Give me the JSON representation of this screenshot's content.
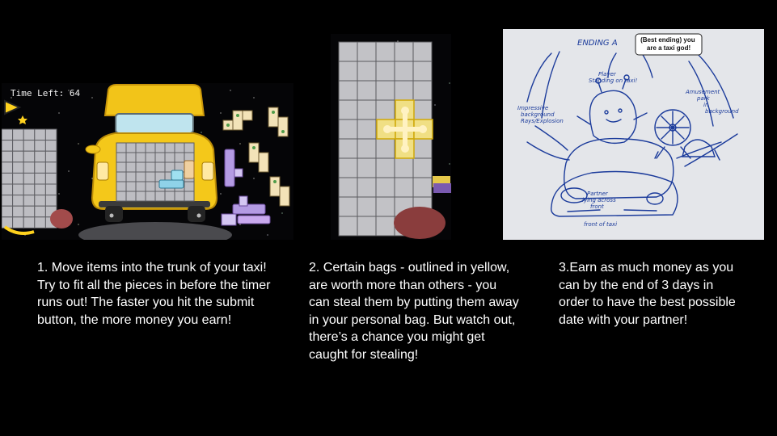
{
  "panel1": {
    "timer_label": "Time Left: 64"
  },
  "panel3": {
    "heading": "ENDING A",
    "speech": "(Best ending) you are a taxi god!",
    "notes": {
      "player": [
        "Player",
        "Standing on taxi!"
      ],
      "background": [
        "Impressive",
        "background",
        "Rays/Explosion"
      ],
      "park": [
        "Amusement",
        "park",
        "in",
        "background"
      ],
      "partner": [
        "Partner",
        "lying across",
        "front"
      ],
      "front": "front of taxi"
    }
  },
  "captions": [
    "1. Move items into the trunk of your taxi! Try to fit all the pieces in before the timer runs out! The faster you hit the submit button, the more money you earn!",
    "2. Certain bags - outlined in yellow, are worth more than others - you can steal them by putting them away in your personal bag. But watch out, there’s a chance you might get caught for stealing!",
    "3.Earn as much money as you can by the end of 3 days in order to have the best possible date with your partner!"
  ]
}
